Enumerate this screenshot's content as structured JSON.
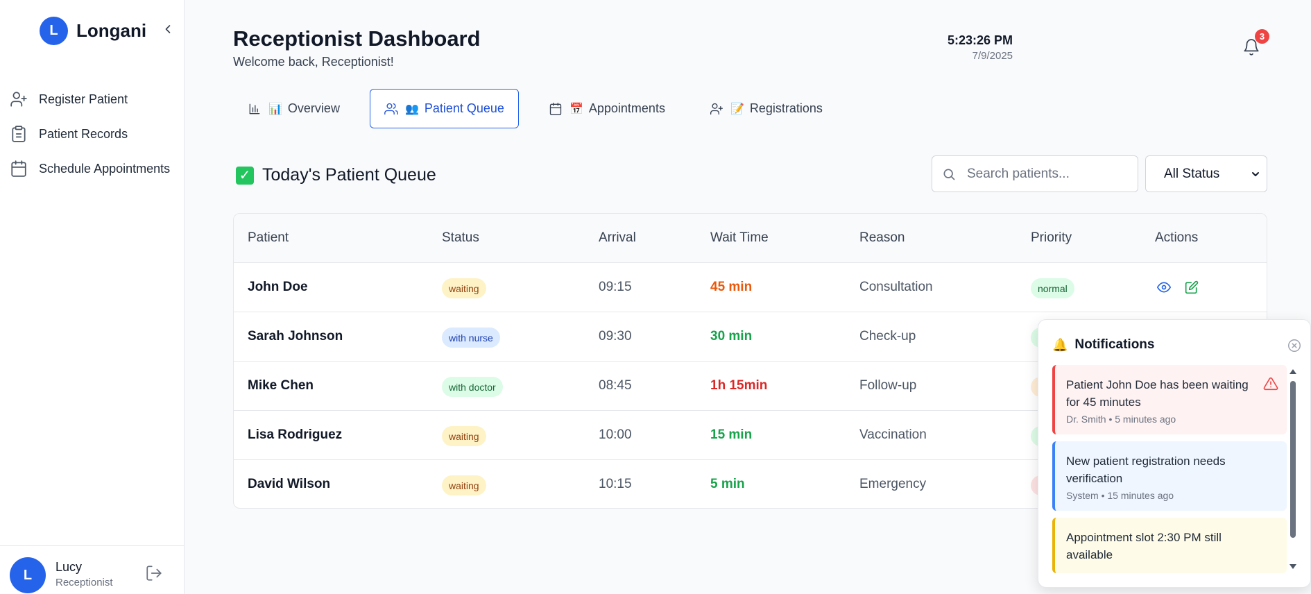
{
  "app": {
    "brand_initial": "L",
    "brand_name": "Longani"
  },
  "sidebar": {
    "items": [
      {
        "label": "Register Patient",
        "icon": "user-plus-icon"
      },
      {
        "label": "Patient Records",
        "icon": "clipboard-icon"
      },
      {
        "label": "Schedule Appointments",
        "icon": "calendar-icon"
      }
    ],
    "user": {
      "initial": "L",
      "name": "Lucy",
      "role": "Receptionist"
    }
  },
  "header": {
    "title": "Receptionist Dashboard",
    "subtitle": "Welcome back, Receptionist!",
    "time": "5:23:26 PM",
    "date": "7/9/2025",
    "notification_count": "3"
  },
  "tabs": [
    {
      "label": "Overview",
      "emoji": "📊",
      "active": false
    },
    {
      "label": "Patient Queue",
      "emoji": "👥",
      "active": true
    },
    {
      "label": "Appointments",
      "emoji": "📅",
      "active": false
    },
    {
      "label": "Registrations",
      "emoji": "📝",
      "active": false
    }
  ],
  "queue": {
    "title": "Today's Patient Queue",
    "check_emoji": "✓",
    "search_placeholder": "Search patients...",
    "status_filter": "All Status",
    "columns": [
      "Patient",
      "Status",
      "Arrival",
      "Wait Time",
      "Reason",
      "Priority",
      "Actions"
    ],
    "rows": [
      {
        "name": "John Doe",
        "status": "waiting",
        "arrival": "09:15",
        "wait": "45 min",
        "reason": "Consultation",
        "priority": "normal"
      },
      {
        "name": "Sarah Johnson",
        "status": "with nurse",
        "arrival": "09:30",
        "wait": "30 min",
        "reason": "Check-up",
        "priority": ""
      },
      {
        "name": "Mike Chen",
        "status": "with doctor",
        "arrival": "08:45",
        "wait": "1h 15min",
        "reason": "Follow-up",
        "priority": ""
      },
      {
        "name": "Lisa Rodriguez",
        "status": "waiting",
        "arrival": "10:00",
        "wait": "15 min",
        "reason": "Vaccination",
        "priority": ""
      },
      {
        "name": "David Wilson",
        "status": "waiting",
        "arrival": "10:15",
        "wait": "5 min",
        "reason": "Emergency",
        "priority": ""
      }
    ]
  },
  "notifications": {
    "title": "Notifications",
    "emoji": "🔔",
    "items": [
      {
        "message": "Patient John Doe has been waiting for 45 minutes",
        "meta": "Dr. Smith • 5 minutes ago",
        "type": "alert"
      },
      {
        "message": "New patient registration needs verification",
        "meta": "System • 15 minutes ago",
        "type": "info"
      },
      {
        "message": "Appointment slot 2:30 PM still available",
        "meta": "",
        "type": "warning"
      }
    ]
  },
  "colors": {
    "accent": "#2563eb",
    "waiting_bg": "#fef3c7",
    "waiting_fg": "#92400e",
    "nurse_bg": "#dbeafe",
    "nurse_fg": "#1e40af",
    "doctor_bg": "#dcfce7",
    "doctor_fg": "#166534",
    "wait_orange": "#ea580c",
    "wait_green": "#16a34a",
    "wait_red": "#dc2626"
  }
}
